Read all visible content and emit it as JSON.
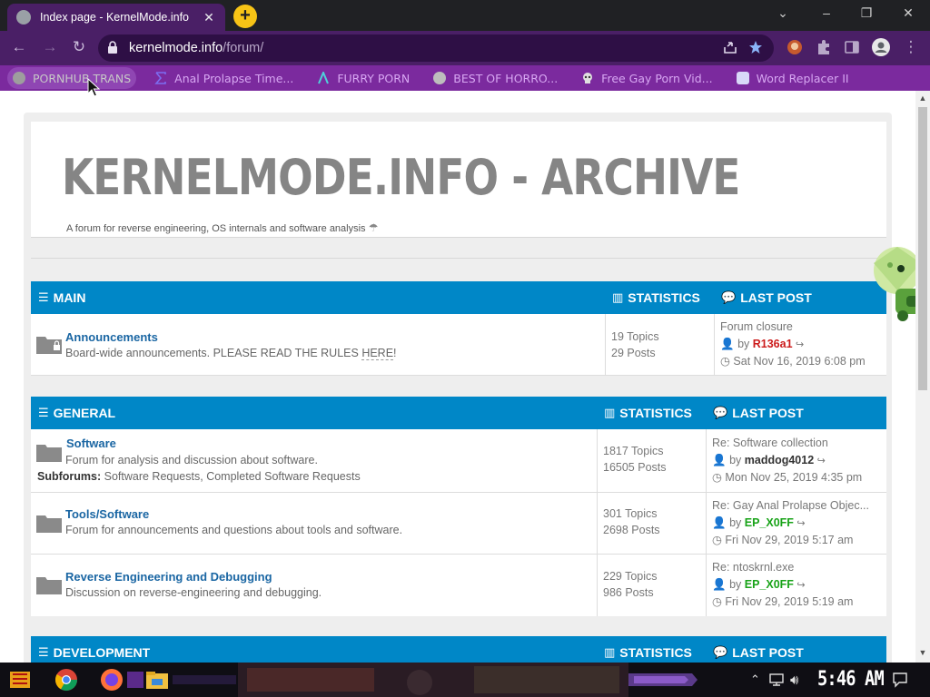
{
  "browser": {
    "tab_title": "Index page - KernelMode.info",
    "tab_close": "✕",
    "new_tab": "+",
    "url_host": "kernelmode.info",
    "url_path": "/forum/",
    "bookmarks": [
      {
        "label": "PORNHUB TRANS"
      },
      {
        "label": "Anal Prolapse Time..."
      },
      {
        "label": "FURRY PORN"
      },
      {
        "label": "BEST OF HORRO..."
      },
      {
        "label": "Free Gay Porn Vid..."
      },
      {
        "label": "Word Replacer II"
      }
    ],
    "theme_colors": {
      "tabstrip": "#202124",
      "toolbar": "#4a1f66",
      "bookmarks_bar": "#7b2a9e"
    }
  },
  "site": {
    "title": "KERNELMODE.INFO - ARCHIVE",
    "description": "A forum for reverse engineering, OS internals and software analysis",
    "accent_color": "#0087c7"
  },
  "categories": [
    {
      "name": "MAIN",
      "stat_header": "STATISTICS",
      "last_header": "LAST POST",
      "forums": [
        {
          "name": "Announcements",
          "desc_pre": "Board-wide announcements. PLEASE READ THE RULES ",
          "desc_link": "HERE",
          "desc_post": "!",
          "topics": "19 Topics",
          "posts": "29 Posts",
          "last_title": "Forum closure",
          "last_by": "by",
          "last_user": "R136a1",
          "last_date": "Sat Nov 16, 2019 6:08 pm"
        }
      ]
    },
    {
      "name": "GENERAL",
      "stat_header": "STATISTICS",
      "last_header": "LAST POST",
      "forums": [
        {
          "name": "Software",
          "desc": "Forum for analysis and discussion about software.",
          "subforums_label": "Subforums:",
          "subforums": [
            "Software Requests",
            "Completed Software Requests"
          ],
          "topics": "1817 Topics",
          "posts": "16505 Posts",
          "last_title": "Re: Software collection",
          "last_by": "by",
          "last_user": "maddog4012",
          "last_date": "Mon Nov 25, 2019 4:35 pm"
        },
        {
          "name": "Tools/Software",
          "desc": "Forum for announcements and questions about tools and software.",
          "topics": "301 Topics",
          "posts": "2698 Posts",
          "last_title": "Re: Gay Anal Prolapse Objec...",
          "last_by": "by",
          "last_user": "EP_X0FF",
          "last_date": "Fri Nov 29, 2019 5:17 am"
        },
        {
          "name": "Reverse Engineering and Debugging",
          "desc": "Discussion on reverse-engineering and debugging.",
          "topics": "229 Topics",
          "posts": "986 Posts",
          "last_title": "Re: ntoskrnl.exe",
          "last_by": "by",
          "last_user": "EP_X0FF",
          "last_date": "Fri Nov 29, 2019 5:19 am"
        }
      ]
    },
    {
      "name": "DEVELOPMENT",
      "stat_header": "STATISTICS",
      "last_header": "LAST POST",
      "forums": []
    }
  ],
  "taskbar": {
    "clock": "5:46 AM"
  }
}
